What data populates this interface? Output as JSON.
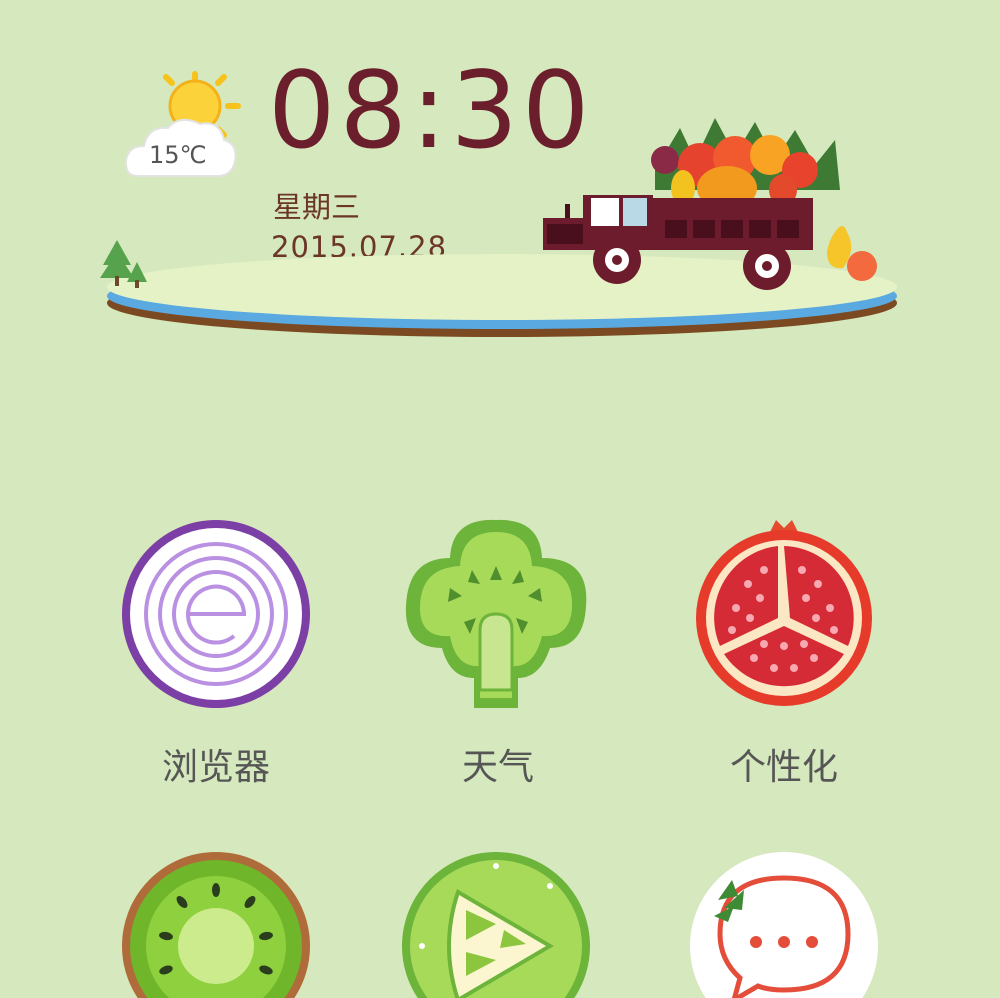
{
  "widget": {
    "time": "08:30",
    "weekday": "星期三",
    "date": "2015.07.28",
    "temperature": "15℃",
    "weather_icon": "sun-cloud-icon"
  },
  "apps": [
    {
      "label": "浏览器",
      "icon": "onion-browser-icon"
    },
    {
      "label": "天气",
      "icon": "broccoli-weather-icon"
    },
    {
      "label": "个性化",
      "icon": "pomegranate-theme-icon"
    },
    {
      "label": "",
      "icon": "kiwi-icon"
    },
    {
      "label": "",
      "icon": "lime-video-icon"
    },
    {
      "label": "",
      "icon": "strawberry-message-icon"
    }
  ],
  "colors": {
    "background": "#d6e8bd",
    "clock": "#6b1e2c",
    "label": "#565656"
  }
}
